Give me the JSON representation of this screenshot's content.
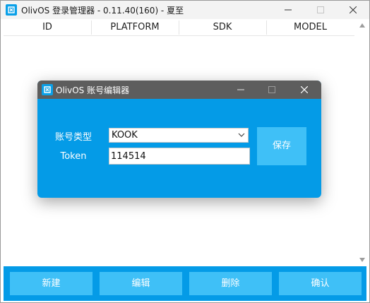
{
  "main_window": {
    "title": "OlivOS 登录管理器 - 0.11.40(160) - 夏至",
    "columns": [
      "ID",
      "PLATFORM",
      "SDK",
      "MODEL"
    ],
    "buttons": {
      "new": "新建",
      "edit": "编辑",
      "delete": "删除",
      "confirm": "确认"
    }
  },
  "dialog": {
    "title": "OlivOS 账号编辑器",
    "account_type_label": "账号类型",
    "account_type_value": "KOOK",
    "token_label": "Token",
    "token_value": "114514",
    "save_label": "保存"
  },
  "colors": {
    "accent": "#049be7",
    "button": "#3fc0f7",
    "dialog_titlebar": "#5d5d5d"
  }
}
